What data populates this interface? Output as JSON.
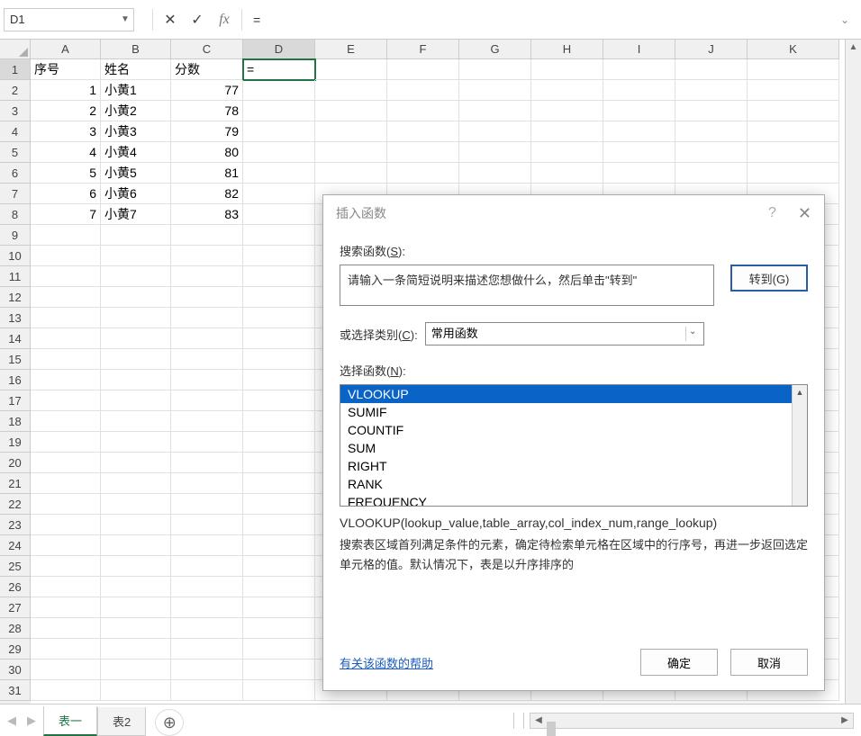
{
  "formula_bar": {
    "name_box": "D1",
    "cancel_icon": "✕",
    "confirm_icon": "✓",
    "fx_label": "fx",
    "formula_value": "=",
    "expand_icon": "⌄"
  },
  "columns": [
    "A",
    "B",
    "C",
    "D",
    "E",
    "F",
    "G",
    "H",
    "I",
    "J",
    "K"
  ],
  "active_col": "D",
  "active_row": 1,
  "row_count": 31,
  "table": {
    "headers": [
      "序号",
      "姓名",
      "分数"
    ],
    "rows": [
      {
        "id": "1",
        "name": "小黄1",
        "score": "77"
      },
      {
        "id": "2",
        "name": "小黄2",
        "score": "78"
      },
      {
        "id": "3",
        "name": "小黄3",
        "score": "79"
      },
      {
        "id": "4",
        "name": "小黄4",
        "score": "80"
      },
      {
        "id": "5",
        "name": "小黄5",
        "score": "81"
      },
      {
        "id": "6",
        "name": "小黄6",
        "score": "82"
      },
      {
        "id": "7",
        "name": "小黄7",
        "score": "83"
      }
    ],
    "d1_value": "="
  },
  "sheet_tabs": {
    "active": "表一",
    "inactive": "表2",
    "new_icon": "⊕",
    "nav_left": "◀",
    "nav_right": "▶"
  },
  "scroll": {
    "up": "▲",
    "down": "▼",
    "left": "◀",
    "right": "▶"
  },
  "dialog": {
    "title": "插入函数",
    "help_icon": "?",
    "close_icon": "✕",
    "search_label_pre": "搜索函数(",
    "search_label_u": "S",
    "search_label_post": "):",
    "search_placeholder": "请输入一条简短说明来描述您想做什么，然后单击\"转到\"",
    "goto_btn": "转到(G)",
    "category_label_pre": "或选择类别(",
    "category_label_u": "C",
    "category_label_post": "):",
    "category_value": "常用函数",
    "select_label_pre": "选择函数(",
    "select_label_u": "N",
    "select_label_post": "):",
    "functions": [
      "VLOOKUP",
      "SUMIF",
      "COUNTIF",
      "SUM",
      "RIGHT",
      "RANK",
      "FREQUENCY"
    ],
    "selected_index": 0,
    "signature": "VLOOKUP(lookup_value,table_array,col_index_num,range_lookup)",
    "description": "搜索表区域首列满足条件的元素，确定待检索单元格在区域中的行序号，再进一步返回选定单元格的值。默认情况下，表是以升序排序的",
    "help_link": "有关该函数的帮助",
    "ok_btn": "确定",
    "cancel_btn": "取消"
  }
}
